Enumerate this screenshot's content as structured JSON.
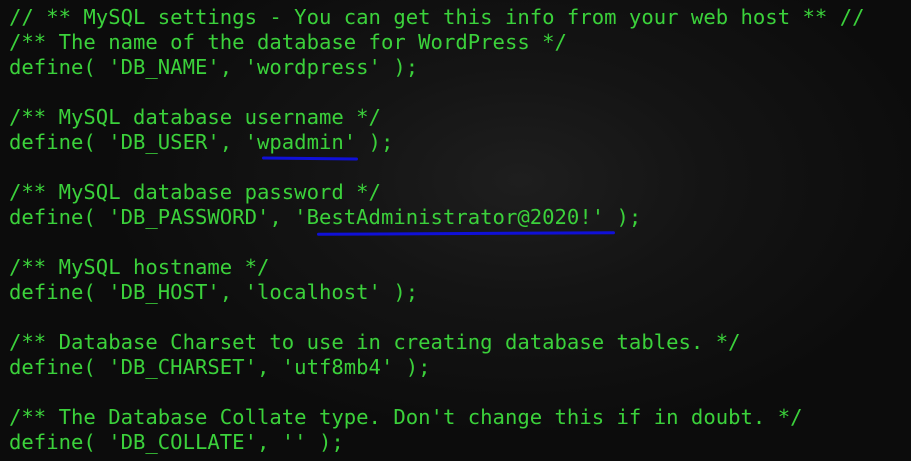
{
  "terminal": {
    "text_color": "#3bd13b",
    "background_color": "#0d0d0d",
    "highlight_color": "#1010d8",
    "lines": [
      "// ** MySQL settings - You can get this info from your web host ** //",
      "/** The name of the database for WordPress */",
      "define( 'DB_NAME', 'wordpress' );",
      "",
      "/** MySQL database username */",
      "define( 'DB_USER', 'wpadmin' );",
      "",
      "/** MySQL database password */",
      "define( 'DB_PASSWORD', 'BestAdministrator@2020!' );",
      "",
      "/** MySQL hostname */",
      "define( 'DB_HOST', 'localhost' );",
      "",
      "/** Database Charset to use in creating database tables. */",
      "define( 'DB_CHARSET', 'utf8mb4' );",
      "",
      "/** The Database Collate type. Don't change this if in doubt. */",
      "define( 'DB_COLLATE', '' );"
    ]
  }
}
